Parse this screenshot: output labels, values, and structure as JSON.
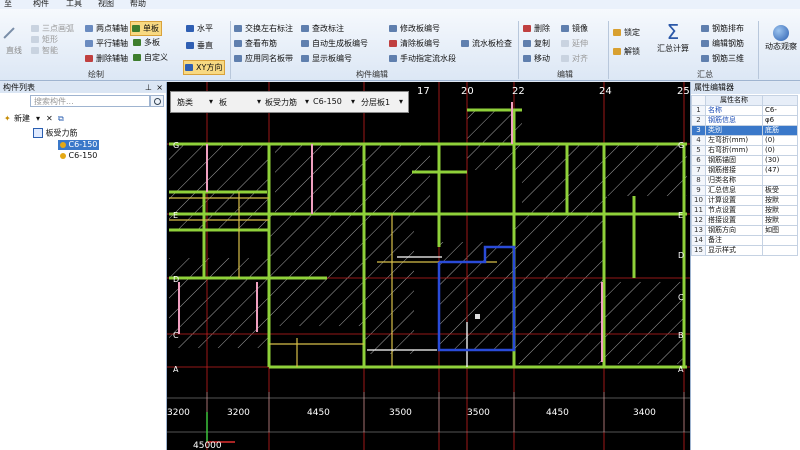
{
  "menubar": {
    "items": [
      "至",
      "构件",
      "工具",
      "视图",
      "帮助"
    ]
  },
  "ribbon": {
    "draw": {
      "label": "绘制",
      "buttons": [
        "直线",
        "三点画弧",
        "智能",
        "矩形",
        "两点辅轴",
        "平行辅轴",
        "删除辅轴",
        "单板",
        "多板",
        "自定义",
        "XY方向",
        "水平",
        "垂直"
      ]
    },
    "edit": {
      "label": "构件编辑",
      "buttons": [
        "交换左右标注",
        "查看布筋",
        "应用同名板带",
        "查改标注",
        "自动生成板编号",
        "显示板编号",
        "修改板编号",
        "清除板编号",
        "手动指定流水段",
        "流水板检查"
      ]
    },
    "modify": {
      "label": "编辑",
      "buttons": [
        "删除",
        "复制",
        "移动",
        "镜像",
        "延伸",
        "对齐"
      ]
    },
    "sum": {
      "label": "汇总",
      "buttons": [
        "锁定",
        "解锁",
        "汇总计算",
        "钢筋排布",
        "编辑钢筋",
        "钢筋三维",
        "动态观察"
      ]
    }
  },
  "left_panel": {
    "title": "构件列表",
    "search_placeholder": "搜索构件...",
    "new_label": "新建",
    "tree_root": "板受力筋",
    "tree_items": [
      "C6-150",
      "C6-150"
    ]
  },
  "canvas": {
    "floatbar": {
      "c1": "筋类",
      "c2": "板",
      "c3": "板受力筋",
      "c4": "C6-150",
      "c5": "分层板1"
    },
    "axis_top": [
      "17",
      "20",
      "22",
      "24",
      "25"
    ],
    "axis_left": [
      "G",
      "E",
      "D",
      "C",
      "B",
      "A"
    ],
    "axis_right": [
      "G",
      "E",
      "D",
      "C",
      "B",
      "A"
    ],
    "dims": [
      "3200",
      "3200",
      "4450",
      "3500",
      "3500",
      "4450",
      "3400"
    ],
    "coord": "45000"
  },
  "right_panel": {
    "title": "属性编辑器",
    "header": {
      "num": "",
      "name": "属性名称",
      "value": ""
    },
    "rows": [
      {
        "n": "1",
        "k": "名称",
        "v": "C6-"
      },
      {
        "n": "2",
        "k": "钢筋信息",
        "v": "φ6"
      },
      {
        "n": "3",
        "k": "类别",
        "v": "底筋"
      },
      {
        "n": "4",
        "k": "左弯折(mm)",
        "v": "(0)"
      },
      {
        "n": "5",
        "k": "右弯折(mm)",
        "v": "(0)"
      },
      {
        "n": "6",
        "k": "钢筋锚固",
        "v": "(30)"
      },
      {
        "n": "7",
        "k": "钢筋搭接",
        "v": "(47)"
      },
      {
        "n": "8",
        "k": "归类名称",
        "v": ""
      },
      {
        "n": "9",
        "k": "汇总信息",
        "v": "板受"
      },
      {
        "n": "10",
        "k": "计算设置",
        "v": "按默"
      },
      {
        "n": "11",
        "k": "节点设置",
        "v": "按默"
      },
      {
        "n": "12",
        "k": "搭接设置",
        "v": "按默"
      },
      {
        "n": "13",
        "k": "钢筋方向",
        "v": "如图"
      },
      {
        "n": "14",
        "k": "备注",
        "v": ""
      },
      {
        "n": "15",
        "k": "显示样式",
        "v": ""
      }
    ],
    "selected_row": 3
  },
  "colors": {
    "beam": "#8fd13a",
    "grid": "#c62020",
    "rebar": "#ffffff",
    "selected": "#2a4bd8",
    "hatch": "#cfcfcf"
  }
}
